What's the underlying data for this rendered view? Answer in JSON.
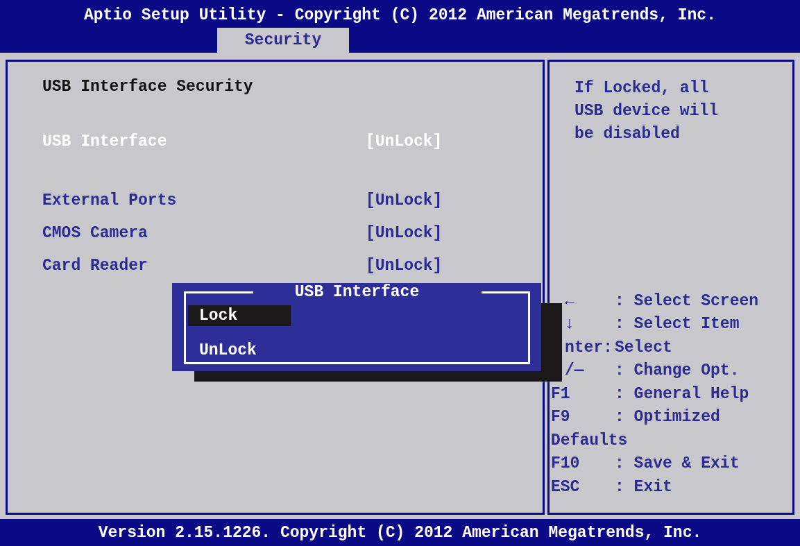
{
  "title": "Aptio Setup Utility - Copyright (C) 2012 American Megatrends, Inc.",
  "tabs": [
    {
      "label": "Security",
      "selected": true
    }
  ],
  "heading": "USB Interface Security",
  "groups": [
    {
      "items": [
        {
          "label": "USB Interface",
          "value": "[UnLock]",
          "selected": true
        }
      ]
    },
    {
      "items": [
        {
          "label": "External Ports",
          "value": "[UnLock]",
          "selected": false
        },
        {
          "label": "CMOS Camera",
          "value": "[UnLock]",
          "selected": false
        },
        {
          "label": "Card Reader",
          "value": "[UnLock]",
          "selected": false
        }
      ]
    }
  ],
  "help_text": "If Locked, all USB device will be disabled",
  "key_help": [
    {
      "kind": "covered",
      "key": "←",
      "desc": ": Select Screen"
    },
    {
      "kind": "covered",
      "key": "↓",
      "desc": ": Select Item"
    },
    {
      "kind": "covered",
      "key": "nter:",
      "desc": "Select"
    },
    {
      "kind": "covered",
      "key": "/—",
      "desc": ": Change Opt."
    },
    {
      "kind": "key",
      "key": "F1",
      "desc": ": General Help"
    },
    {
      "kind": "key",
      "key": "F9",
      "desc": ": Optimized"
    },
    {
      "kind": "wrap",
      "desc": "Defaults"
    },
    {
      "kind": "key",
      "key": "F10",
      "desc": ": Save & Exit"
    },
    {
      "kind": "key",
      "key": "ESC",
      "desc": ": Exit"
    }
  ],
  "popup": {
    "title": "USB Interface",
    "options": [
      {
        "label": "Lock",
        "selected": true
      },
      {
        "label": "UnLock",
        "selected": false
      }
    ]
  },
  "footer": "Version 2.15.1226. Copyright (C) 2012 American Megatrends, Inc."
}
